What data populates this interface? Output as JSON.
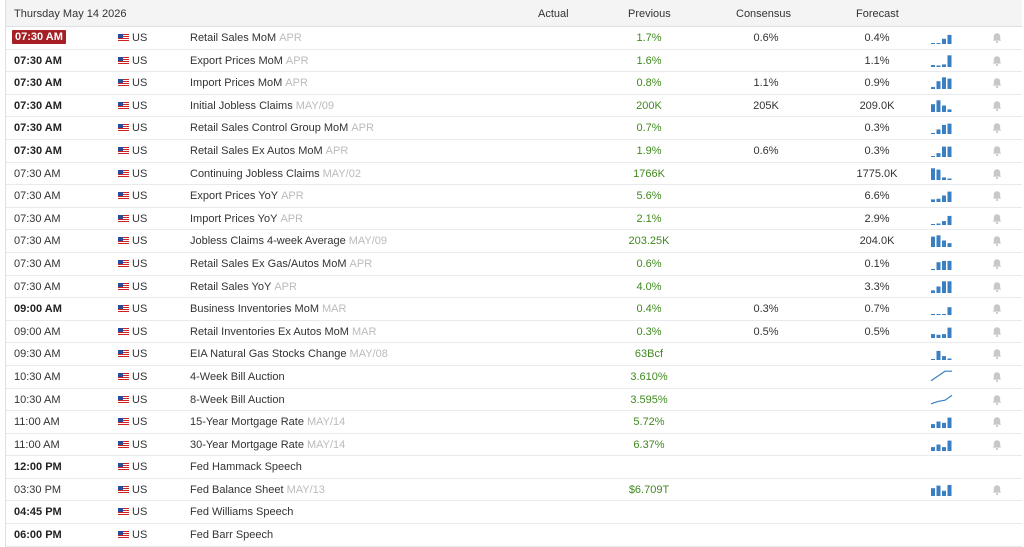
{
  "header": {
    "date": "Thursday May 14 2026",
    "col_actual": "Actual",
    "col_previous": "Previous",
    "col_consensus": "Consensus",
    "col_forecast": "Forecast"
  },
  "colors": {
    "accent_time": "#a51f24",
    "previous_green": "#3f8a1e",
    "chart_blue": "#3a7fc1",
    "bell_gray": "#c8c8c8"
  },
  "rows": [
    {
      "time": "07:30 AM",
      "style": "hl",
      "country": "US",
      "event": "Retail Sales MoM",
      "period": "APR",
      "actual": "",
      "previous": "1.7%",
      "consensus": "0.6%",
      "forecast": "0.4%",
      "spark": [
        0,
        0,
        0.4,
        0.7
      ],
      "bell": true
    },
    {
      "time": "07:30 AM",
      "style": "bold",
      "country": "US",
      "event": "Export Prices MoM",
      "period": "APR",
      "actual": "",
      "previous": "1.6%",
      "consensus": "",
      "forecast": "1.1%",
      "spark": [
        0.15,
        0.1,
        0.2,
        0.9
      ],
      "bell": true
    },
    {
      "time": "07:30 AM",
      "style": "bold",
      "country": "US",
      "event": "Import Prices MoM",
      "period": "APR",
      "actual": "",
      "previous": "0.8%",
      "consensus": "1.1%",
      "forecast": "0.9%",
      "spark": [
        0.15,
        0.6,
        0.9,
        0.8
      ],
      "bell": true
    },
    {
      "time": "07:30 AM",
      "style": "bold",
      "country": "US",
      "event": "Initial Jobless Claims",
      "period": "MAY/09",
      "actual": "",
      "previous": "200K",
      "consensus": "205K",
      "forecast": "209.0K",
      "spark": [
        0.6,
        0.9,
        0.5,
        0.2
      ],
      "bell": true
    },
    {
      "time": "07:30 AM",
      "style": "bold",
      "country": "US",
      "event": "Retail Sales Control Group MoM",
      "period": "APR",
      "actual": "",
      "previous": "0.7%",
      "consensus": "",
      "forecast": "0.3%",
      "spark": [
        0,
        0.35,
        0.7,
        0.8
      ],
      "bell": true
    },
    {
      "time": "07:30 AM",
      "style": "bold",
      "country": "US",
      "event": "Retail Sales Ex Autos MoM",
      "period": "APR",
      "actual": "",
      "previous": "1.9%",
      "consensus": "0.6%",
      "forecast": "0.3%",
      "spark": [
        0,
        0.3,
        0.8,
        0.8
      ],
      "bell": true
    },
    {
      "time": "07:30 AM",
      "style": "normal",
      "country": "US",
      "event": "Continuing Jobless Claims",
      "period": "MAY/02",
      "actual": "",
      "previous": "1766K",
      "consensus": "",
      "forecast": "1775.0K",
      "spark": [
        0.9,
        0.8,
        0.2,
        0.05
      ],
      "bell": true
    },
    {
      "time": "07:30 AM",
      "style": "normal",
      "country": "US",
      "event": "Export Prices YoY",
      "period": "APR",
      "actual": "",
      "previous": "5.6%",
      "consensus": "",
      "forecast": "6.6%",
      "spark": [
        0.2,
        0.25,
        0.5,
        0.8
      ],
      "bell": true
    },
    {
      "time": "07:30 AM",
      "style": "normal",
      "country": "US",
      "event": "Import Prices YoY",
      "period": "APR",
      "actual": "",
      "previous": "2.1%",
      "consensus": "",
      "forecast": "2.9%",
      "spark": [
        0,
        0.1,
        0.3,
        0.7
      ],
      "bell": true
    },
    {
      "time": "07:30 AM",
      "style": "normal",
      "country": "US",
      "event": "Jobless Claims 4-week Average",
      "period": "MAY/09",
      "actual": "",
      "previous": "203.25K",
      "consensus": "",
      "forecast": "204.0K",
      "spark": [
        0.8,
        0.9,
        0.5,
        0.3
      ],
      "bell": true
    },
    {
      "time": "07:30 AM",
      "style": "normal",
      "country": "US",
      "event": "Retail Sales Ex Gas/Autos MoM",
      "period": "APR",
      "actual": "",
      "previous": "0.6%",
      "consensus": "",
      "forecast": "0.1%",
      "spark": [
        0,
        0.6,
        0.7,
        0.7
      ],
      "bell": true
    },
    {
      "time": "07:30 AM",
      "style": "normal",
      "country": "US",
      "event": "Retail Sales YoY",
      "period": "APR",
      "actual": "",
      "previous": "4.0%",
      "consensus": "",
      "forecast": "3.3%",
      "spark": [
        0.2,
        0.5,
        0.9,
        0.9
      ],
      "bell": true
    },
    {
      "time": "09:00 AM",
      "style": "bold",
      "country": "US",
      "event": "Business Inventories MoM",
      "period": "MAR",
      "actual": "",
      "previous": "0.4%",
      "consensus": "0.3%",
      "forecast": "0.7%",
      "spark": [
        0,
        0,
        0,
        0.6
      ],
      "bell": true
    },
    {
      "time": "09:00 AM",
      "style": "normal",
      "country": "US",
      "event": "Retail Inventories Ex Autos MoM",
      "period": "MAR",
      "actual": "",
      "previous": "0.3%",
      "consensus": "0.5%",
      "forecast": "0.5%",
      "spark": [
        0.3,
        0.25,
        0.3,
        0.8
      ],
      "bell": true
    },
    {
      "time": "09:30 AM",
      "style": "normal",
      "country": "US",
      "event": "EIA Natural Gas Stocks Change",
      "period": "MAY/08",
      "actual": "",
      "previous": "63Bcf",
      "consensus": "",
      "forecast": "",
      "spark": [
        0,
        0.7,
        0.3,
        0.1
      ],
      "bell": true
    },
    {
      "time": "10:30 AM",
      "style": "normal",
      "country": "US",
      "event": "4-Week Bill Auction",
      "period": "",
      "actual": "",
      "previous": "3.610%",
      "consensus": "",
      "forecast": "",
      "line": [
        0.1,
        0.5,
        0.9,
        0.9
      ],
      "bell": true
    },
    {
      "time": "10:30 AM",
      "style": "normal",
      "country": "US",
      "event": "8-Week Bill Auction",
      "period": "",
      "actual": "",
      "previous": "3.595%",
      "consensus": "",
      "forecast": "",
      "line": [
        0.1,
        0.3,
        0.4,
        0.8
      ],
      "bell": true
    },
    {
      "time": "11:00 AM",
      "style": "normal",
      "country": "US",
      "event": "15-Year Mortgage Rate",
      "period": "MAY/14",
      "actual": "",
      "previous": "5.72%",
      "consensus": "",
      "forecast": "",
      "spark": [
        0.3,
        0.5,
        0.4,
        0.8
      ],
      "bell": true
    },
    {
      "time": "11:00 AM",
      "style": "normal",
      "country": "US",
      "event": "30-Year Mortgage Rate",
      "period": "MAY/14",
      "actual": "",
      "previous": "6.37%",
      "consensus": "",
      "forecast": "",
      "spark": [
        0.3,
        0.5,
        0.3,
        0.8
      ],
      "bell": true
    },
    {
      "time": "12:00 PM",
      "style": "bold",
      "country": "US",
      "event": "Fed Hammack Speech",
      "period": "",
      "actual": "",
      "previous": "",
      "consensus": "",
      "forecast": "",
      "bell": false
    },
    {
      "time": "03:30 PM",
      "style": "normal",
      "country": "US",
      "event": "Fed Balance Sheet",
      "period": "MAY/13",
      "actual": "",
      "previous": "$6.709T",
      "consensus": "",
      "forecast": "",
      "spark": [
        0.6,
        0.8,
        0.4,
        0.85
      ],
      "bell": true
    },
    {
      "time": "04:45 PM",
      "style": "bold",
      "country": "US",
      "event": "Fed Williams Speech",
      "period": "",
      "actual": "",
      "previous": "",
      "consensus": "",
      "forecast": "",
      "bell": false
    },
    {
      "time": "06:00 PM",
      "style": "bold",
      "country": "US",
      "event": "Fed Barr Speech",
      "period": "",
      "actual": "",
      "previous": "",
      "consensus": "",
      "forecast": "",
      "bell": false
    }
  ]
}
